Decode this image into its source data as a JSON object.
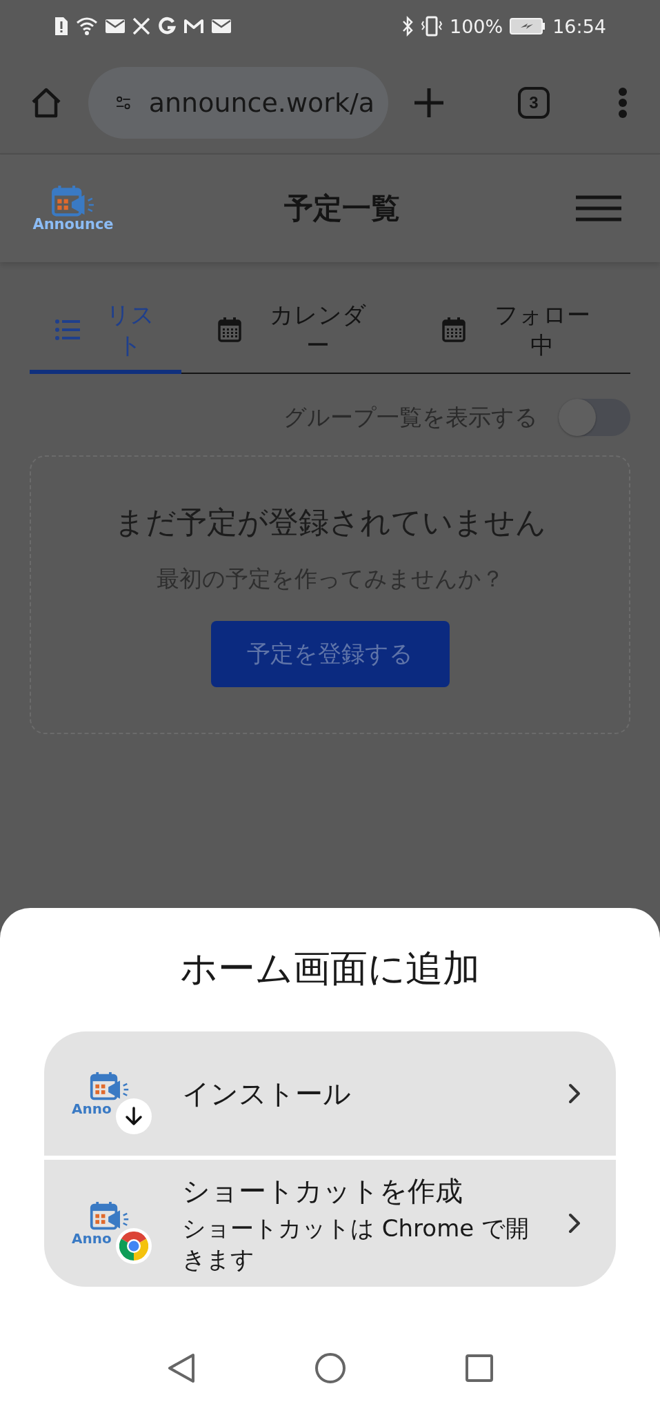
{
  "status_bar": {
    "battery": "100%",
    "time": "16:54"
  },
  "browser": {
    "url": "announce.work/a",
    "tab_count": "3"
  },
  "header": {
    "logo_text": "Announce",
    "title": "予定一覧"
  },
  "tabs": [
    {
      "label": "リスト",
      "kind": "list",
      "selected": true
    },
    {
      "label": "カレンダー",
      "kind": "calendar",
      "selected": false
    },
    {
      "label": "フォロー中",
      "kind": "calendar",
      "selected": false
    }
  ],
  "group_toggle": {
    "label": "グループ一覧を表示する",
    "on": false
  },
  "empty_state": {
    "title": "まだ予定が登録されていません",
    "subtitle": "最初の予定を作ってみませんか？",
    "button": "予定を登録する"
  },
  "sheet": {
    "title": "ホーム画面に追加",
    "options": [
      {
        "kind": "install",
        "logo_text": "Anno",
        "title": "インストール"
      },
      {
        "kind": "shortcut",
        "logo_text": "Anno",
        "title": "ショートカットを作成",
        "description": "ショートカットは Chrome で開きます"
      }
    ]
  }
}
